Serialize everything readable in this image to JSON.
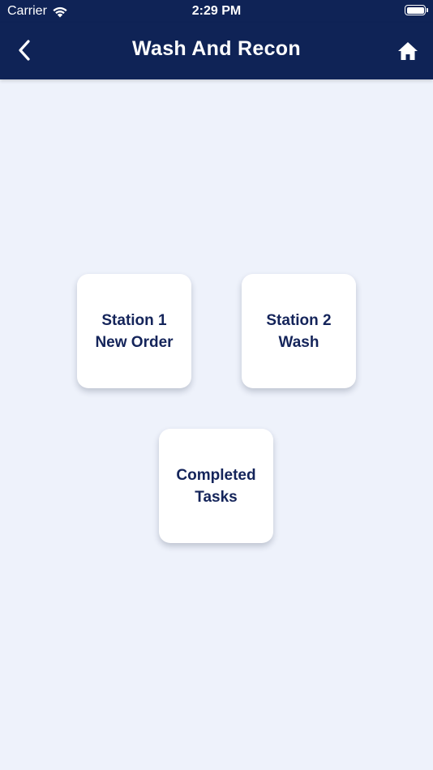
{
  "status_bar": {
    "carrier": "Carrier",
    "time": "2:29 PM"
  },
  "nav": {
    "title": "Wash And Recon",
    "back_icon": "chevron-left-icon",
    "home_icon": "home-icon"
  },
  "colors": {
    "header_bg": "#0f2356",
    "page_bg": "#eef2fb",
    "tile_bg": "#ffffff",
    "tile_text": "#14245a"
  },
  "tiles": [
    {
      "line1": "Station 1",
      "line2": "New Order"
    },
    {
      "line1": "Station 2",
      "line2": "Wash"
    },
    {
      "line1": "Completed",
      "line2": "Tasks"
    }
  ]
}
